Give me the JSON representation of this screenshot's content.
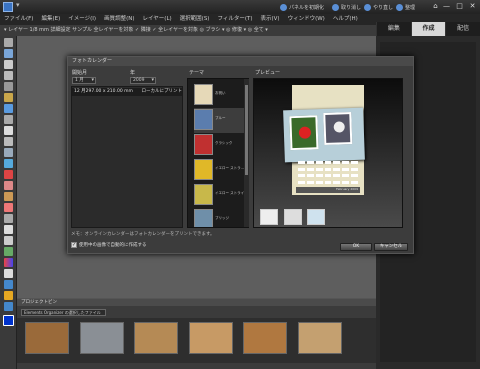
{
  "window": {
    "menu_arrow": "▾"
  },
  "titlebar": {
    "right_items": [
      "パネルを初期化",
      "取り消し",
      "やり直し",
      "整理"
    ],
    "win_controls": [
      "—",
      "□",
      "✕"
    ]
  },
  "menubar": {
    "items": [
      "ファイル(F)",
      "編集(E)",
      "イメージ(I)",
      "画質調整(N)",
      "レイヤー(L)",
      "選択範囲(S)",
      "フィルター(T)",
      "表示(V)",
      "ウィンドウ(W)",
      "ヘルプ(H)"
    ]
  },
  "optionsbar": {
    "text": "▾ レイヤー 1/8 mm 詳細設定   サンプル 全レイヤーを対象   ✓ 隣接   ✓ 全レイヤーを対象   ◎ ブラシ ▾   ◎ 修復 ▾   ◎ 全て ▾"
  },
  "tabs": [
    {
      "label": "編集",
      "active": false
    },
    {
      "label": "作成",
      "active": true
    },
    {
      "label": "配信",
      "active": false
    }
  ],
  "dialog": {
    "title": "フォトカレンダー",
    "start_label": "開始月",
    "year_label": "年",
    "theme_label": "テーマ",
    "preview_label": "プレビュー",
    "start_month_value": "1 月",
    "start_year_value": "2009",
    "start_row": {
      "col1": "12 月",
      "col2": "297.00 x 210.00 mm",
      "col3": "ローカルにプリント"
    },
    "themes": [
      {
        "label": "お祝い",
        "color": "#e6d9b8"
      },
      {
        "label": "ブルー",
        "color": "#5b7dae"
      },
      {
        "label": "クラシック",
        "color": "#c03030"
      },
      {
        "label": "イエロー ストラ…",
        "color": "#e0b828"
      },
      {
        "label": "イエロー ストライプ",
        "color": "#c8b84a"
      },
      {
        "label": "ブリッジ",
        "color": "#6f8fa9"
      }
    ],
    "preview_caption": "February 2009",
    "notice": "メモ：オンラインカレンダーはフォトカレンダーをプリントできます。",
    "checkbox_label": "使用中の画像で自動的に作成する",
    "checkbox_checked": true,
    "ok_label": "OK",
    "cancel_label": "キャンセル"
  },
  "bin": {
    "title": "プロジェクトビン",
    "dropdown_value": "Elements Organizer の選択したファイル",
    "thumb_colors": [
      "#9a6a3a",
      "#8a8f95",
      "#b58a55",
      "#c79a65",
      "#b07840",
      "#c4a070"
    ]
  },
  "colors": {
    "accent": "#3a74c4",
    "dialog_bg": "#3c3c3c",
    "tab_active": "#d8d8d8"
  }
}
